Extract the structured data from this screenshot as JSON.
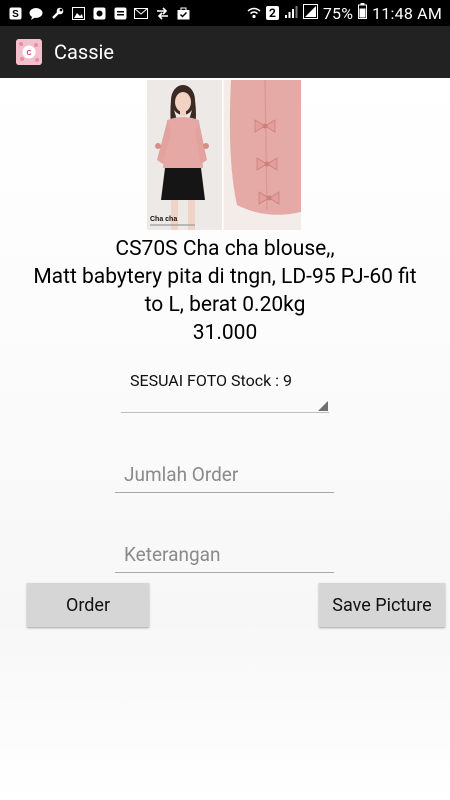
{
  "statusbar": {
    "sim_badge": "2",
    "battery_percent": "75%",
    "time": "11:48 AM"
  },
  "appbar": {
    "title": "Cassie"
  },
  "product": {
    "image_caption": "Cha cha",
    "line1": "CS70S Cha cha blouse,,",
    "line2": "Matt babytery pita di tngn, LD-95 PJ-60 fit",
    "line3": "to L, berat 0.20kg",
    "price": "31.000"
  },
  "variant_select": {
    "value": "SESUAI FOTO Stock : 9"
  },
  "order_qty_input": {
    "placeholder": "Jumlah Order"
  },
  "note_input": {
    "placeholder": "Keterangan"
  },
  "buttons": {
    "order": "Order",
    "save_picture": "Save Picture"
  },
  "colors": {
    "status_bar": "#000000",
    "action_bar": "#222222",
    "button": "#d6d6d6"
  }
}
